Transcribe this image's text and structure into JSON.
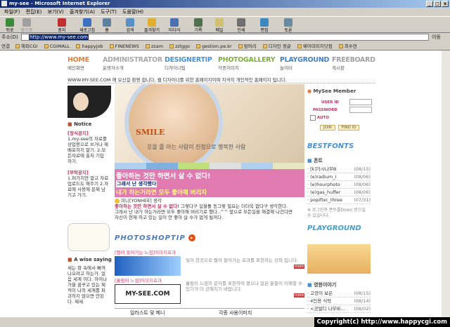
{
  "window": {
    "title": "my-see - Microsoft Internet Explorer"
  },
  "menu": [
    "파일(F)",
    "편집(E)",
    "보기(V)",
    "즐겨찾기(A)",
    "도구(T)",
    "도움말(H)"
  ],
  "toolbar": [
    {
      "label": "뒤로",
      "icon": "back-arrow-icon"
    },
    {
      "label": "앞으로",
      "icon": "forward-arrow-icon"
    },
    {
      "label": "중지",
      "icon": "stop-icon"
    },
    {
      "label": "새로고침",
      "icon": "refresh-icon"
    },
    {
      "label": "홈",
      "icon": "home-icon"
    },
    {
      "label": "검색",
      "icon": "search-icon"
    },
    {
      "label": "즐겨찾기",
      "icon": "favorites-icon"
    },
    {
      "label": "미디어",
      "icon": "media-icon"
    },
    {
      "label": "기록",
      "icon": "history-icon"
    },
    {
      "label": "메일",
      "icon": "mail-icon"
    },
    {
      "label": "인쇄",
      "icon": "print-icon"
    },
    {
      "label": "편집",
      "icon": "edit-icon"
    },
    {
      "label": "토론",
      "icon": "discuss-icon"
    }
  ],
  "address": {
    "label": "주소(D)",
    "url": "http://www.my-see.com",
    "go": "이동"
  },
  "links": {
    "label": "연결",
    "items": [
      "해피CGI",
      "CGIMALL",
      "happyjob",
      "FINENEWS",
      "zzam",
      "zzlggo",
      "gestion.pe.kr",
      "맘머리",
      "디자인 정글",
      "웨어미미지닷컴",
      "최수연"
    ]
  },
  "nav": [
    {
      "title": "HOME",
      "sub": "메인화면",
      "color": "#e08040"
    },
    {
      "title": "ADMINISTRATOR",
      "sub": "운영자소개",
      "color": "#a8a8a8"
    },
    {
      "title": "DESIGNERTIP",
      "sub": "디자이너팁",
      "color": "#4a90d0"
    },
    {
      "title": "PHOTOGALLERY",
      "sub": "각종이미지",
      "color": "#80b040"
    },
    {
      "title": "PLAYGROUND",
      "sub": "놀이터",
      "color": "#4080c0"
    },
    {
      "title": "FREEBOARD",
      "sub": "게시판",
      "color": "#a0a0a0"
    }
  ],
  "marquee": "WWW.MY-SEE.COM 에 오신걸 환영 합니다. 웹 디자이너를 위한 홈페이지이며 지극히 개인적인 홈페이지 입니다.",
  "banner": {
    "smile": "SMILE",
    "caption": "웃을 줄 아는 사람이 진정으로 행복한 사람"
  },
  "pink": {
    "line1": "좋아하는 것만 하면서 살 수 없다!",
    "line2": "그래서 난 생각했다",
    "line3": "내가 하는거라면 모두 좋아해 버리자"
  },
  "quote": {
    "author": "미니[YONHEE] 생각",
    "text1": "좋아하는 것만 하면서 살 수 없다!",
    "text2": " 그렇다구 일을돌 동그렇 필요는 더더욱 없다구 생각한다.",
    "text3": "그래서 난 내가 하는거라면 모두 좋아해 버리기로 했다..^^ 앞으로 모든일을 해결해 나간다면",
    "text4": "자신이 현재 하고 있는 일이 안 좋아 살 수가 없게 될꺼다."
  },
  "photoshop": {
    "heading": "PHOTOSHOPTIP",
    "items": [
      {
        "link": "[빨려 들어가는 느낌]이미지효과",
        "desc": "빛이 한곳으로 빨려 들어가는 효과를 표현하는 강좌 입니다.",
        "thumb": "blue-light"
      },
      {
        "link": "[흘림이 느낌]이미지효과",
        "desc": "흘림이 느낌의 문자를 표현하여 봤으나 많은 분들이 이해할 수 있기가 더 강해지기 바랍니다.",
        "thumb": "MY-SEE.COM"
      }
    ],
    "more": "more"
  },
  "bottom": {
    "left": "일러스트 및 메니",
    "right": "각종 사용이미지"
  },
  "left": {
    "notice_title": "Notice",
    "notice1_title": "[정식공지]",
    "notice1": "1.my-see의 자료를 상업용으로 쓰거나 재배포하지 말기. 2.모든자료에 출처 기입 하기.",
    "notice2_title": "[부탁공지]",
    "notice2": "1.퍼가지만 말고 자료 업로드도 해주기 2.자료에 사용에 문제 남기고 가기.",
    "wise_title": "A wise saying",
    "wise": "세는 항 속에서 빠져나오려고 하는가. 얼음 세계 이다. 하이나 가을 꿈꾸고 있는 제 적이 나의 세계를 파괴하지 않으면 안된다. 제세"
  },
  "right": {
    "member_title": "MySee Member",
    "user_id": "USER ID",
    "password": "PASSWORD",
    "auto": "AUTO",
    "join": "JOIN",
    "find": "FIND ID",
    "font_title": "BESTFONTS",
    "font_sub": "폰트",
    "fonts": [
      {
        "name": "[k]가시나무B",
        "date": "(08/15)"
      },
      {
        "name": "(e)radium_i",
        "date": "(08/06)"
      },
      {
        "name": "(e)hourphoto",
        "date": "(08/06)"
      },
      {
        "name": "(e)gas_huffer",
        "date": "(08/06)"
      },
      {
        "name": "popifixc_three",
        "date": "(07/31)"
      }
    ],
    "font_note": "※ 로그인후 폰트를Down 받으실 수 있습니다.",
    "play": "PLAYGROUND",
    "book_title": "영원이야기",
    "books": [
      {
        "name": "고양이 보은",
        "date": "(08/15)"
      },
      {
        "name": "4인용 식탁",
        "date": "(08/14)"
      },
      {
        "name": "<공발디 나무바...",
        "date": "(08/02)"
      }
    ]
  },
  "footer": {
    "copyright": "Copyright(c) http://www.happycgi.com"
  }
}
